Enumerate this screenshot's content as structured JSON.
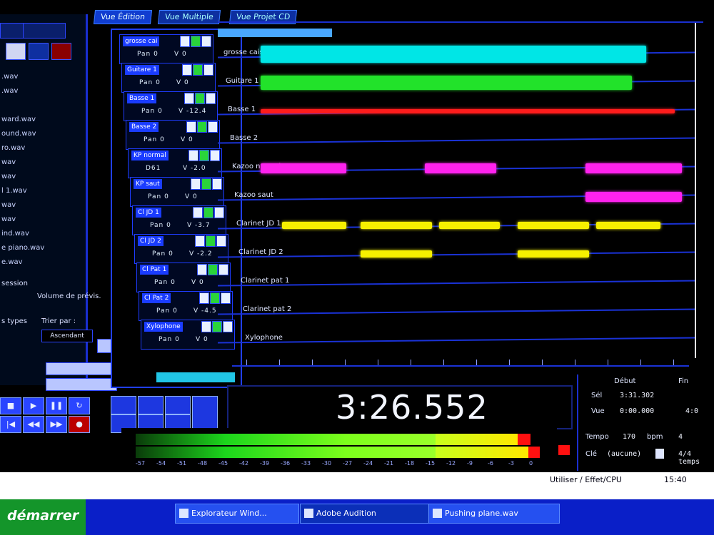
{
  "view_tabs": [
    "Vue Édition",
    "Vue Multiple",
    "Vue Projet CD"
  ],
  "left_panel": {
    "files": [
      ".wav",
      ".wav",
      "",
      "ward.wav",
      "ound.wav",
      "ro.wav",
      "wav",
      "wav",
      "l 1.wav",
      "wav",
      "wav",
      "ind.wav",
      "e piano.wav",
      "e.wav"
    ],
    "labels": {
      "session": "session",
      "volume": "Volume de prévis.",
      "types": "s types",
      "tri": "Trier par :",
      "asc": "Ascendant"
    }
  },
  "mixer": {
    "tracks": [
      {
        "name": "grosse cai",
        "pan": "Pan 0",
        "vol": "V 0"
      },
      {
        "name": "Guitare 1",
        "pan": "Pan 0",
        "vol": "V 0"
      },
      {
        "name": "Basse 1",
        "pan": "Pan 0",
        "vol": "V -12.4"
      },
      {
        "name": "Basse 2",
        "pan": "Pan 0",
        "vol": "V 0"
      },
      {
        "name": "KP normal",
        "pan": "D61",
        "vol": "V -2.0"
      },
      {
        "name": "KP saut",
        "pan": "Pan 0",
        "vol": "V 0"
      },
      {
        "name": "Cl JD 1",
        "pan": "Pan 0",
        "vol": "V -3.7"
      },
      {
        "name": "Cl JD 2",
        "pan": "Pan 0",
        "vol": "V -2.2"
      },
      {
        "name": "Cl Pat 1",
        "pan": "Pan 0",
        "vol": "V 0"
      },
      {
        "name": "Cl Pat 2",
        "pan": "Pan 0",
        "vol": "V -4.5"
      },
      {
        "name": "Xylophone",
        "pan": "Pan 0",
        "vol": "V 0"
      }
    ]
  },
  "tracks": [
    {
      "name": "grosse caisse"
    },
    {
      "name": "Guitare 1"
    },
    {
      "name": "Basse 1"
    },
    {
      "name": "Basse 2"
    },
    {
      "name": "Kazoo normal"
    },
    {
      "name": "Kazoo saut"
    },
    {
      "name": "Clarinet JD 1"
    },
    {
      "name": "Clarinet JD 2"
    },
    {
      "name": "Clarinet pat 1"
    },
    {
      "name": "Clarinet pat 2"
    },
    {
      "name": "Xylophone"
    }
  ],
  "counter": "3:26.552",
  "info": {
    "header": "Début",
    "header2": "Fin",
    "sel_label": "Sél",
    "sel_value": "3:31.302",
    "vue_label": "Vue",
    "vue_value": "0:00.000",
    "fin_value": "4:0",
    "tempo_label": "Tempo",
    "tempo_value": "170",
    "bpm_label": "bpm",
    "bpm_num": "4",
    "key_label": "Clé",
    "key_value": "(aucune)",
    "sig_value": "4/4 temps"
  },
  "meter_scale": [
    "-57",
    "-54",
    "-51",
    "-48",
    "-45",
    "-42",
    "-39",
    "-36",
    "-33",
    "-30",
    "-27",
    "-24",
    "-21",
    "-18",
    "-15",
    "-12",
    "-9",
    "-6",
    "-3",
    "0"
  ],
  "taskbar": {
    "start": "démarrer",
    "items": [
      "Explorateur Wind...",
      "Adobe Audition",
      "Pushing plane.wav"
    ],
    "tray_left": "Utiliser / Effet/CPU",
    "clock": "15:40"
  },
  "colors": {
    "bg": "#000000",
    "accent_blue": "#1a32d6",
    "cyan_wave": "#00e6e6",
    "green_wave": "#22e22a",
    "red_wave": "#ff1c1c",
    "magenta_clip": "#ff22ee",
    "yellow_clip": "#f6f000"
  }
}
